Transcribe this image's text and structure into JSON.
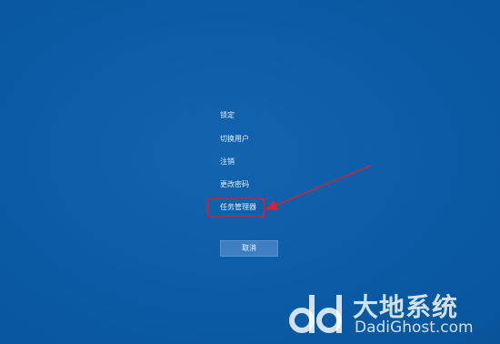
{
  "colors": {
    "background": "#0a5ca6",
    "menu_text": "#e6eef7",
    "annotation_red": "#c8283e",
    "button_bg": "#3d7fc0"
  },
  "menu": {
    "items": [
      {
        "label": "锁定"
      },
      {
        "label": "切换用户"
      },
      {
        "label": "注销"
      },
      {
        "label": "更改密码"
      },
      {
        "label": "任务管理器"
      }
    ]
  },
  "cancel_button": {
    "label": "取消"
  },
  "watermark": {
    "chinese": "大地系统",
    "english": "DadiGhost.com",
    "logo_icon": "dd-logo-icon"
  }
}
